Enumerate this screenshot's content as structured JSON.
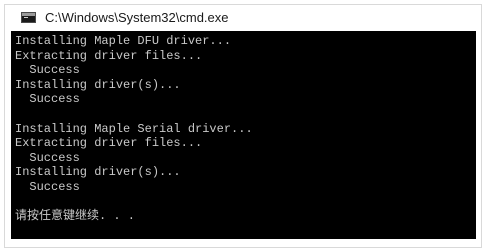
{
  "window": {
    "title": "C:\\Windows\\System32\\cmd.exe",
    "icon": "console-icon"
  },
  "console": {
    "lines": [
      "Installing Maple DFU driver...",
      "Extracting driver files...",
      "  Success",
      "Installing driver(s)...",
      "  Success",
      "",
      "Installing Maple Serial driver...",
      "Extracting driver files...",
      "  Success",
      "Installing driver(s)...",
      "  Success",
      "",
      "请按任意键继续. . ."
    ]
  }
}
